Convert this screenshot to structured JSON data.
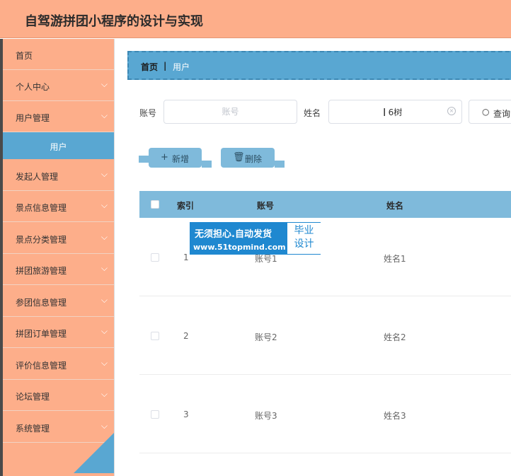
{
  "app": {
    "title": "自驾游拼团小程序的设计与实现"
  },
  "sidebar": {
    "items": [
      {
        "label": "首页"
      },
      {
        "label": "个人中心"
      },
      {
        "label": "用户管理"
      },
      {
        "label": "用户"
      },
      {
        "label": "发起人管理"
      },
      {
        "label": "景点信息管理"
      },
      {
        "label": "景点分类管理"
      },
      {
        "label": "拼团旅游管理"
      },
      {
        "label": "参团信息管理"
      },
      {
        "label": "拼团订单管理"
      },
      {
        "label": "评价信息管理"
      },
      {
        "label": "论坛管理"
      },
      {
        "label": "系统管理"
      }
    ]
  },
  "breadcrumb": {
    "home": "首页",
    "separator": "|",
    "current": "用户"
  },
  "filters": {
    "account_label": "账号",
    "account_placeholder": "账号",
    "name_label": "姓名",
    "name_value": "6树"
  },
  "buttons": {
    "search": "查询",
    "add": "新增",
    "delete": "删除"
  },
  "table": {
    "columns": [
      "索引",
      "账号",
      "姓名"
    ],
    "rows": [
      {
        "index": "1",
        "account": "账号1",
        "name": "姓名1"
      },
      {
        "index": "2",
        "account": "账号2",
        "name": "姓名2"
      },
      {
        "index": "3",
        "account": "账号3",
        "name": "姓名3"
      }
    ]
  },
  "watermark": {
    "line1": "无须担心.自动发货",
    "line2": "www.51topmind.com",
    "badge_line1": "毕业",
    "badge_line2": "设计"
  },
  "colors": {
    "accent_orange": "#fdae8a",
    "accent_blue": "#59a7d2",
    "header_blue": "#7fbadb"
  }
}
